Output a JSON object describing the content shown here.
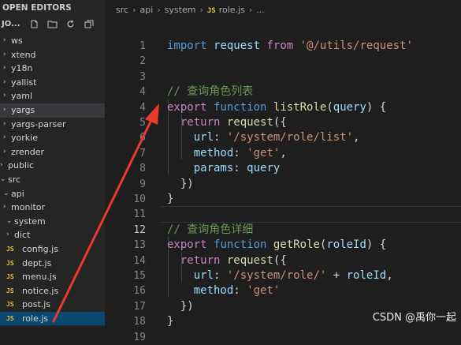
{
  "sidebar": {
    "header": "OPEN EDITORS",
    "toolbar_label": "JO...",
    "rows": [
      {
        "label": "ws",
        "chevron": "›"
      },
      {
        "label": "xtend",
        "chevron": "›"
      },
      {
        "label": "y18n",
        "chevron": "›"
      },
      {
        "label": "yallist",
        "chevron": "›"
      },
      {
        "label": "yaml",
        "chevron": "›"
      },
      {
        "label": "yargs",
        "chevron": "›"
      },
      {
        "label": "yargs-parser",
        "chevron": "›"
      },
      {
        "label": "yorkie",
        "chevron": "›"
      },
      {
        "label": "zrender",
        "chevron": "›"
      },
      {
        "label": "public",
        "chevron": "›"
      },
      {
        "label": "src",
        "chevron": "⌄"
      },
      {
        "label": "api",
        "chevron": "⌄"
      },
      {
        "label": "monitor",
        "chevron": "›"
      },
      {
        "label": "system",
        "chevron": "⌄"
      },
      {
        "label": "dict",
        "chevron": "›"
      },
      {
        "label": "config.js",
        "icon": "JS"
      },
      {
        "label": "dept.js",
        "icon": "JS"
      },
      {
        "label": "menu.js",
        "icon": "JS"
      },
      {
        "label": "notice.js",
        "icon": "JS"
      },
      {
        "label": "post.js",
        "icon": "JS"
      },
      {
        "label": "role.js",
        "icon": "JS"
      }
    ]
  },
  "breadcrumb": {
    "items": [
      "src",
      "api",
      "system"
    ],
    "file_icon": "JS",
    "file": "role.js",
    "tail": "..."
  },
  "editor": {
    "lines": [
      {
        "n": "1",
        "tokens": [
          [
            "k",
            "import"
          ],
          [
            "p",
            " "
          ],
          [
            "v",
            "request"
          ],
          [
            "p",
            " "
          ],
          [
            "c",
            "from"
          ],
          [
            "p",
            " "
          ],
          [
            "s",
            "'@/utils/request'"
          ]
        ]
      },
      {
        "n": "2",
        "tokens": []
      },
      {
        "n": "3",
        "tokens": []
      },
      {
        "n": "4",
        "tokens": [
          [
            "cm",
            "// 查询角色列表"
          ]
        ]
      },
      {
        "n": "4",
        "tokens": [
          [
            "c",
            "export"
          ],
          [
            "p",
            " "
          ],
          [
            "k",
            "function"
          ],
          [
            "p",
            " "
          ],
          [
            "f",
            "listRole"
          ],
          [
            "p",
            "("
          ],
          [
            "v",
            "query"
          ],
          [
            "p",
            ") {"
          ]
        ]
      },
      {
        "n": "5",
        "tokens": [
          [
            "p",
            "  "
          ],
          [
            "c",
            "return"
          ],
          [
            "p",
            " "
          ],
          [
            "f",
            "request"
          ],
          [
            "p",
            "({"
          ]
        ]
      },
      {
        "n": "6",
        "tokens": [
          [
            "p",
            "    "
          ],
          [
            "v",
            "url"
          ],
          [
            "p",
            ": "
          ],
          [
            "s",
            "'/system/role/list'"
          ],
          [
            "p",
            ","
          ]
        ]
      },
      {
        "n": "7",
        "tokens": [
          [
            "p",
            "    "
          ],
          [
            "v",
            "method"
          ],
          [
            "p",
            ": "
          ],
          [
            "s",
            "'get'"
          ],
          [
            "p",
            ","
          ]
        ]
      },
      {
        "n": "8",
        "tokens": [
          [
            "p",
            "    "
          ],
          [
            "v",
            "params"
          ],
          [
            "p",
            ": "
          ],
          [
            "v",
            "query"
          ]
        ]
      },
      {
        "n": "9",
        "tokens": [
          [
            "p",
            "  })"
          ]
        ]
      },
      {
        "n": "10",
        "tokens": [
          [
            "p",
            "}"
          ]
        ]
      },
      {
        "n": "11",
        "tokens": []
      },
      {
        "n": "12",
        "tokens": [
          [
            "cm",
            "// 查询角色详细"
          ]
        ]
      },
      {
        "n": "13",
        "tokens": [
          [
            "c",
            "export"
          ],
          [
            "p",
            " "
          ],
          [
            "k",
            "function"
          ],
          [
            "p",
            " "
          ],
          [
            "f",
            "getRole"
          ],
          [
            "p",
            "("
          ],
          [
            "v",
            "roleId"
          ],
          [
            "p",
            ") {"
          ]
        ]
      },
      {
        "n": "14",
        "tokens": [
          [
            "p",
            "  "
          ],
          [
            "c",
            "return"
          ],
          [
            "p",
            " "
          ],
          [
            "f",
            "request"
          ],
          [
            "p",
            "({"
          ]
        ]
      },
      {
        "n": "15",
        "tokens": [
          [
            "p",
            "    "
          ],
          [
            "v",
            "url"
          ],
          [
            "p",
            ": "
          ],
          [
            "s",
            "'/system/role/'"
          ],
          [
            "p",
            " + "
          ],
          [
            "v",
            "roleId"
          ],
          [
            "p",
            ","
          ]
        ]
      },
      {
        "n": "16",
        "tokens": [
          [
            "p",
            "    "
          ],
          [
            "v",
            "method"
          ],
          [
            "p",
            ": "
          ],
          [
            "s",
            "'get'"
          ]
        ]
      },
      {
        "n": "17",
        "tokens": [
          [
            "p",
            "  })"
          ]
        ]
      },
      {
        "n": "18",
        "tokens": [
          [
            "p",
            "}"
          ]
        ]
      },
      {
        "n": "19",
        "tokens": []
      }
    ]
  },
  "watermark": "CSDN @禹你一起",
  "colors": {
    "arrow": "#ea3a2a",
    "selected_row": "#094771"
  }
}
